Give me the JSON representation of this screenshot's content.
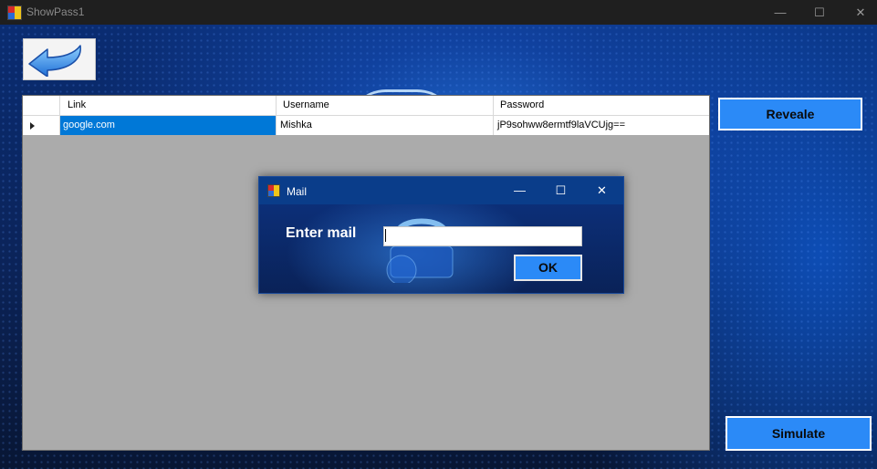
{
  "window": {
    "title": "ShowPass1",
    "minimize_glyph": "—",
    "maximize_glyph": "☐",
    "close_glyph": "✕"
  },
  "toolbar": {
    "back_icon": "arrow-back-icon"
  },
  "grid": {
    "columns": [
      "Link",
      "Username",
      "Password"
    ],
    "rows": [
      {
        "link": "google.com",
        "username": "Mishka",
        "password": "jP9sohww8ermtf9laVCUjg=="
      }
    ],
    "selected_color": "#0078d7"
  },
  "actions": {
    "reveal_label": "Reveale",
    "simulate_label": "Simulate",
    "button_color": "#2b8af7"
  },
  "dialog": {
    "title": "Mail",
    "minimize_glyph": "—",
    "maximize_glyph": "☐",
    "close_glyph": "✕",
    "prompt_label": "Enter mail",
    "input_value": "",
    "ok_label": "OK"
  }
}
